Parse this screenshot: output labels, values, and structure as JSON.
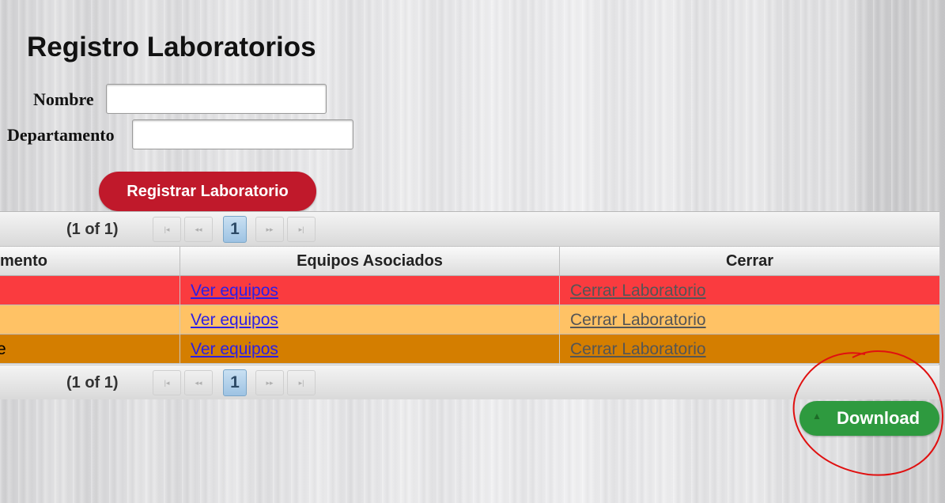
{
  "page": {
    "title": "Registro Laboratorios"
  },
  "form": {
    "nombre_label": "Nombre",
    "nombre_value": "",
    "departamento_label": "Departamento",
    "departamento_value": "",
    "register_button": "Registrar Laboratorio"
  },
  "paginator": {
    "report": "(1 of 1)",
    "current_page": "1",
    "first_icon": "first-page-icon",
    "prev_icon": "prev-page-icon",
    "next_icon": "next-page-icon",
    "last_icon": "last-page-icon"
  },
  "table": {
    "headers": [
      "mento",
      "Equipos Asociados",
      "Cerrar"
    ],
    "rows": [
      {
        "first": "",
        "equipos": "Ver equipos",
        "cerrar": "Cerrar Laboratorio",
        "color": "#fa3b3f"
      },
      {
        "first": "",
        "equipos": "Ver equipos",
        "cerrar": "Cerrar Laboratorio",
        "color": "#ffc265"
      },
      {
        "first": "e",
        "equipos": "Ver equipos",
        "cerrar": "Cerrar Laboratorio",
        "color": "#d47e00"
      }
    ]
  },
  "download": {
    "label": "Download",
    "icon": "chevron-up-icon",
    "color": "#2e9a3f"
  },
  "colors": {
    "register_button": "#c0192b",
    "annotation_circle": "#e01010"
  }
}
